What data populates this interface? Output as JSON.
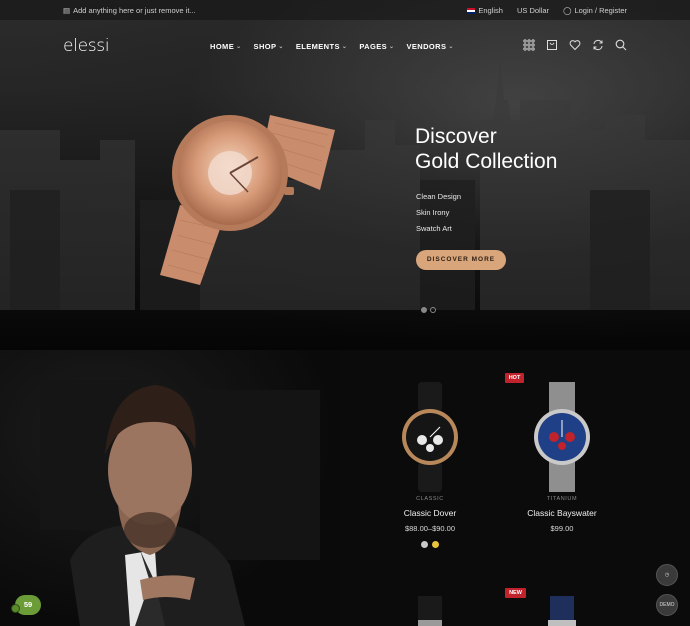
{
  "topbar": {
    "announcement": "Add anything here or just remove it...",
    "language": "English",
    "currency": "US Dollar",
    "account": "Login / Register"
  },
  "header": {
    "logo": "elessi",
    "nav": [
      "HOME",
      "SHOP",
      "ELEMENTS",
      "PAGES",
      "VENDORS"
    ],
    "icons": [
      "grid-icon",
      "cart-icon",
      "heart-icon",
      "compare-icon",
      "search-icon"
    ]
  },
  "hero": {
    "title_line1": "Discover",
    "title_line2": "Gold Collection",
    "features": [
      "Clean Design",
      "Skin Irony",
      "Swatch Art"
    ],
    "button": "DISCOVER MORE",
    "slides": 2,
    "active_slide": 1
  },
  "products": [
    {
      "category": "CLASSIC",
      "name": "Classic Dover",
      "price": "$88.00–$90.00",
      "badge": "",
      "swatches": [
        "#c9c9c9",
        "#e7c43b"
      ]
    },
    {
      "category": "TITANIUM",
      "name": "Classic Bayswater",
      "price": "$99.00",
      "badge": "HOT",
      "swatches": []
    },
    {
      "category": "",
      "name": "",
      "price": "",
      "badge": "",
      "swatches": []
    },
    {
      "category": "",
      "name": "",
      "price": "",
      "badge": "NEW",
      "swatches": []
    }
  ],
  "cart_count": "59",
  "side_buttons": [
    "",
    "DEMO"
  ],
  "colors": {
    "accent": "#d9a57a",
    "badge": "#c0232b",
    "cart": "#6c9c37"
  }
}
